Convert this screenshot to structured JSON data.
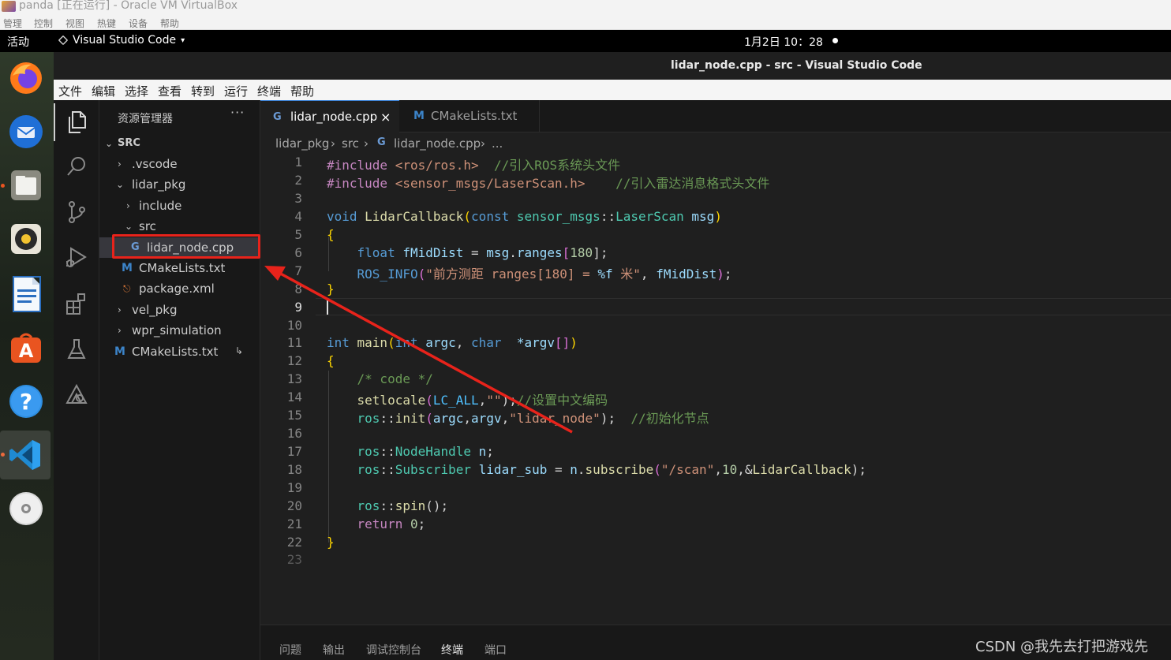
{
  "vbox": {
    "title": "panda [正在运行] - Oracle VM VirtualBox",
    "menu": [
      "管理",
      "控制",
      "视图",
      "热键",
      "设备",
      "帮助"
    ]
  },
  "gnome": {
    "activities": "活动",
    "app_name": "Visual Studio Code",
    "app_caret": "▾",
    "clock": "1月2日 10：28"
  },
  "dock": {
    "items": [
      "firefox-icon",
      "thunderbird-icon",
      "files-icon",
      "rhythmbox-icon",
      "libreoffice-writer-icon",
      "app-center-icon",
      "help-icon",
      "vscode-icon",
      "dvd-icon"
    ]
  },
  "window": {
    "title": "lidar_node.cpp - src - Visual Studio Code"
  },
  "menubar": [
    "文件",
    "编辑",
    "选择",
    "查看",
    "转到",
    "运行",
    "终端",
    "帮助"
  ],
  "explorer": {
    "header": "资源管理器",
    "more": "···",
    "root": "SRC",
    "tree": [
      {
        "chev": "›",
        "label": ".vscode"
      },
      {
        "chev": "⌄",
        "label": "lidar_pkg"
      },
      {
        "chev": "›",
        "label": "include"
      },
      {
        "chev": "⌄",
        "label": "src"
      },
      {
        "icon": "G",
        "label": "lidar_node.cpp"
      },
      {
        "icon": "M",
        "label": "CMakeLists.txt"
      },
      {
        "icon": "⎋",
        "label": "package.xml"
      },
      {
        "chev": "›",
        "label": "vel_pkg"
      },
      {
        "chev": "›",
        "label": "wpr_simulation"
      },
      {
        "icon": "M",
        "label": "CMakeLists.txt"
      }
    ],
    "git_mark": "↳"
  },
  "tabs": [
    {
      "icon": "G",
      "label": "lidar_node.cpp",
      "close": "×"
    },
    {
      "icon": "M",
      "label": "CMakeLists.txt"
    }
  ],
  "breadcrumb": [
    "lidar_pkg",
    "›",
    "src",
    "›",
    "G",
    "lidar_node.cpp",
    "›",
    "..."
  ],
  "editor": {
    "line_numbers": [
      "1",
      "2",
      "3",
      "4",
      "5",
      "6",
      "7",
      "8",
      "9",
      "10",
      "11",
      "12",
      "13",
      "14",
      "15",
      "16",
      "17",
      "18",
      "19",
      "20",
      "21",
      "22",
      "23"
    ],
    "current_line": "9",
    "code": {
      "l1a": "#include ",
      "l1b": "<ros/ros.h>",
      "l1c": "  //引入ROS系统头文件",
      "l2a": "#include ",
      "l2b": "<sensor_msgs/LaserScan.h>",
      "l2c": "    //引入雷达消息格式头文件",
      "l4a": "void ",
      "l4b": "LidarCallback",
      "l4c": "(",
      "l4d": "const ",
      "l4e": "sensor_msgs",
      "l4f": "::",
      "l4g": "LaserScan",
      "l4h": " msg",
      "l4i": ")",
      "l5": "{",
      "l6a": "    float ",
      "l6b": "fMidDist",
      "l6c": " = ",
      "l6d": "msg",
      "l6e": ".",
      "l6f": "ranges",
      "l6g": "[",
      "l6h": "180",
      "l6i": "];",
      "l7a": "    ROS_INFO",
      "l7b": "(",
      "l7c": "\"前方测距 ranges[180] = ",
      "l7d": "%f",
      "l7e": " 米\"",
      "l7f": ", ",
      "l7g": "fMidDist",
      "l7h": ")",
      "l7i": ";",
      "l8": "}",
      "l11a": "int ",
      "l11b": "main",
      "l11c": "(",
      "l11d": "int ",
      "l11e": "argc",
      "l11f": ", ",
      "l11g": "char ",
      "l11h": " *argv",
      "l11i": "[]",
      "l11j": ")",
      "l12": "{",
      "l13": "    /* code */",
      "l14a": "    setlocale",
      "l14b": "(",
      "l14c": "LC_ALL",
      "l14d": ",",
      "l14e": "\"\"",
      "l14f": ");",
      "l14g": "//设置中文编码",
      "l15a": "    ros",
      "l15b": "::",
      "l15c": "init",
      "l15d": "(",
      "l15e": "argc",
      "l15f": ",",
      "l15g": "argv",
      "l15h": ",",
      "l15i": "\"lidar_node\"",
      "l15j": ");  ",
      "l15k": "//初始化节点",
      "l17a": "    ros",
      "l17b": "::",
      "l17c": "NodeHandle",
      "l17d": " n",
      "l17e": ";",
      "l18a": "    ros",
      "l18b": "::",
      "l18c": "Subscriber",
      "l18d": " lidar_sub",
      "l18e": " = ",
      "l18f": "n",
      "l18g": ".",
      "l18h": "subscribe",
      "l18i": "(",
      "l18j": "\"/scan\"",
      "l18k": ",",
      "l18l": "10",
      "l18m": ",&",
      "l18n": "LidarCallback",
      "l18o": ");",
      "l20a": "    ros",
      "l20b": "::",
      "l20c": "spin",
      "l20d": "();",
      "l21a": "    return ",
      "l21b": "0",
      "l21c": ";",
      "l22": "}"
    }
  },
  "panel": [
    "问题",
    "输出",
    "调试控制台",
    "终端",
    "端口"
  ],
  "watermark": "CSDN @我先去打把游戏先",
  "colors": {
    "accent_tab": "#3b82d6",
    "highlight_box": "#e8231b",
    "arrow": "#e8231b"
  }
}
